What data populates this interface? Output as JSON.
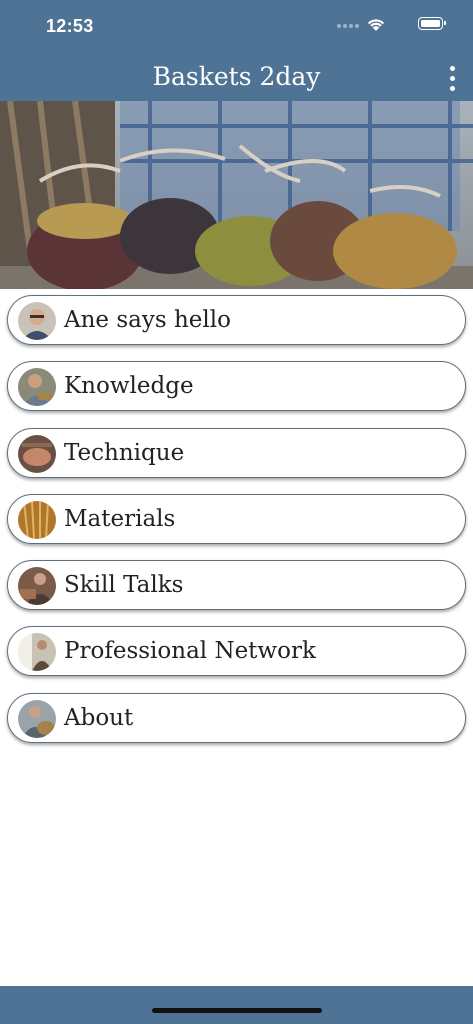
{
  "status_bar": {
    "time": "12:53"
  },
  "header": {
    "title": "Baskets 2day",
    "menu_icon": "vertical-dots-icon"
  },
  "hero": {
    "image": "woven-willow-baskets-photo"
  },
  "menu": {
    "items": [
      {
        "label": "Ane says hello",
        "avatar": "portrait-woman-glasses"
      },
      {
        "label": "Knowledge",
        "avatar": "woman-weaving-outdoors"
      },
      {
        "label": "Technique",
        "avatar": "hands-weaving-closeup"
      },
      {
        "label": "Materials",
        "avatar": "willow-rods-golden"
      },
      {
        "label": "Skill Talks",
        "avatar": "weaver-at-work-brown"
      },
      {
        "label": "Professional Network",
        "avatar": "workshop-group"
      },
      {
        "label": "About",
        "avatar": "weaver-with-basket"
      }
    ]
  },
  "colors": {
    "bar": "#4f7394",
    "border": "#5e6f80",
    "text": "#222222"
  }
}
